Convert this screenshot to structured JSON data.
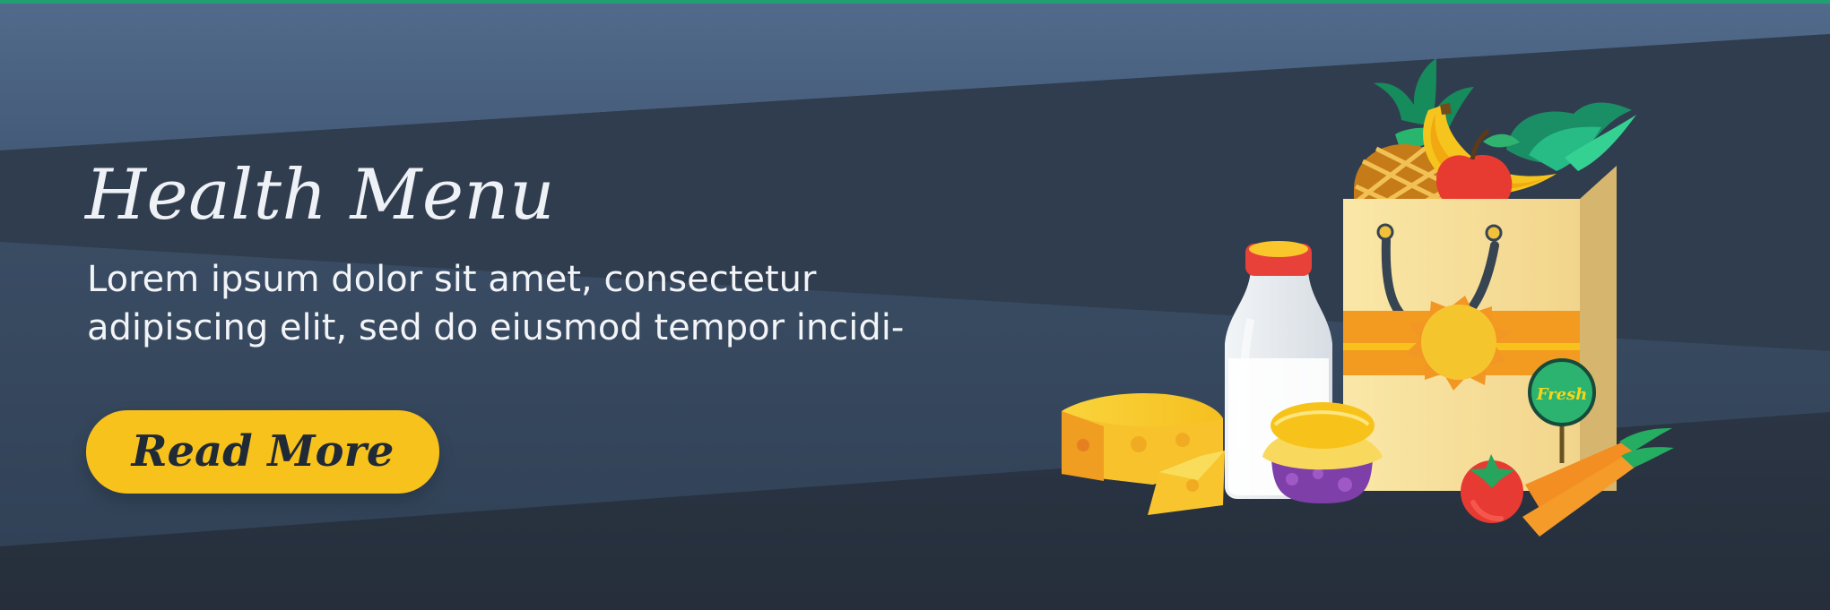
{
  "banner": {
    "title": "Health Menu",
    "body_lines": [
      "Lorem ipsum dolor sit amet, consectetur",
      "adipiscing elit, sed do eiusmod tempor incidi-"
    ],
    "button_label": "Read More"
  },
  "illustration": {
    "fresh_label": "Fresh",
    "icons": [
      "grocery-bag-icon",
      "milk-bottle-icon",
      "cheese-icon",
      "jam-jar-icon",
      "pineapple-icon",
      "banana-icon",
      "apple-icon",
      "lettuce-icon",
      "tomato-icon",
      "carrot-icon"
    ]
  },
  "colors": {
    "background_dark": "#2f3a4b",
    "background_blue": "#4e6584",
    "accent_yellow": "#f8c21c",
    "top_line": "#20a070"
  }
}
